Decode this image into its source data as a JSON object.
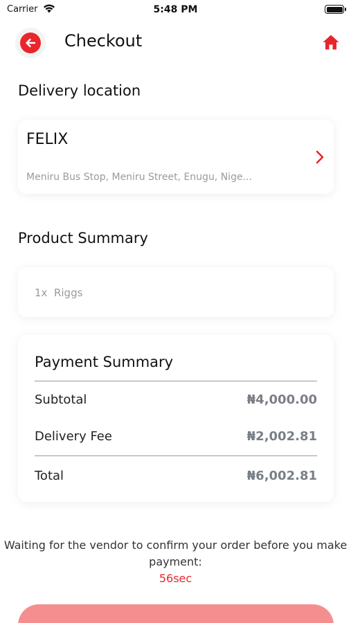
{
  "status_bar": {
    "carrier": "Carrier",
    "time": "5:48 PM",
    "wifi_icon": "wifi-icon",
    "battery_icon": "battery-icon"
  },
  "header": {
    "title": "Checkout",
    "back_icon": "arrow-left-icon",
    "home_icon": "home-icon"
  },
  "delivery": {
    "section_title": "Delivery location",
    "name": "FELIX",
    "address": "Meniru Bus Stop, Meniru Street, Enugu, Nige...",
    "chevron_icon": "chevron-right-icon"
  },
  "product_summary": {
    "section_title": "Product Summary",
    "items": [
      {
        "quantity": "1x",
        "name": "Riggs"
      }
    ]
  },
  "payment_summary": {
    "title": "Payment Summary",
    "subtotal_label": "Subtotal",
    "subtotal_value": "₦4,000.00",
    "delivery_fee_label": "Delivery Fee",
    "delivery_fee_value": "₦2,002.81",
    "total_label": "Total",
    "total_value": "₦6,002.81"
  },
  "notice": {
    "message": "Waiting for the vendor to confirm your order before you make payment:",
    "countdown": "56sec"
  },
  "colors": {
    "accent": "#e8262b",
    "button_disabled": "#f58f8f",
    "muted_text": "#9a9a9a",
    "value_text": "#7a7f86"
  }
}
